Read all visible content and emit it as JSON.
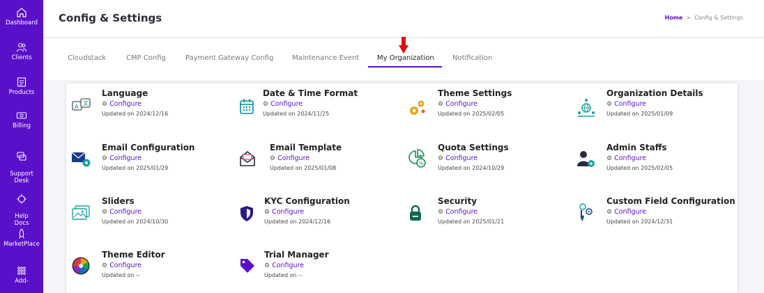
{
  "sidebar": {
    "items": [
      {
        "label": "Dashboard",
        "icon": "home-icon"
      },
      {
        "label": "Clients",
        "icon": "users-icon"
      },
      {
        "label": "Products",
        "icon": "products-icon"
      },
      {
        "label": "Billing",
        "icon": "billing-icon"
      },
      {
        "label": "Support\nDesk",
        "icon": "support-icon"
      },
      {
        "label": "Help\nDocs",
        "icon": "help-icon"
      },
      {
        "label": "MarketPlace",
        "icon": "rocket-icon"
      },
      {
        "label": "Add-",
        "icon": "grid-icon"
      }
    ]
  },
  "header": {
    "title": "Config & Settings",
    "breadcrumb": {
      "home": "Home",
      "separator": ">",
      "current": "Config & Settings"
    }
  },
  "tabs": [
    {
      "label": "Cloudstack"
    },
    {
      "label": "CMP Config"
    },
    {
      "label": "Payment Gateway Config"
    },
    {
      "label": "Maintenance Event"
    },
    {
      "label": "My Organization"
    },
    {
      "label": "Notification"
    }
  ],
  "active_tab": "My Organization",
  "accent_color": "#5a0fc8",
  "configure_label": "Configure",
  "tiles": [
    {
      "title": "Language",
      "updated": "Updated on 2024/12/16",
      "icon": "language-icon"
    },
    {
      "title": "Date & Time Format",
      "updated": "Updated on 2024/11/25",
      "icon": "calendar-icon"
    },
    {
      "title": "Theme Settings",
      "updated": "Updated on 2025/02/05",
      "icon": "gears-icon"
    },
    {
      "title": "Organization Details",
      "updated": "Updated on 2025/01/09",
      "icon": "organization-icon"
    },
    {
      "title": "Email Configuration",
      "updated": "Updated on 2025/01/29",
      "icon": "email-config-icon"
    },
    {
      "title": "Email Template",
      "updated": "Updated on 2025/01/08",
      "icon": "email-template-icon"
    },
    {
      "title": "Quota Settings",
      "updated": "Updated on 2024/10/29",
      "icon": "quota-icon"
    },
    {
      "title": "Admin Staffs",
      "updated": "Updated on 2025/02/05",
      "icon": "admin-icon"
    },
    {
      "title": "Sliders",
      "updated": "Updated on 2024/10/30",
      "icon": "sliders-icon"
    },
    {
      "title": "KYC Configuration",
      "updated": "Updated on 2024/12/16",
      "icon": "shield-icon"
    },
    {
      "title": "Security",
      "updated": "Updated on 2025/01/21",
      "icon": "lock-icon"
    },
    {
      "title": "Custom Field Configuration",
      "updated": "Updated on 2024/12/31",
      "icon": "custom-field-icon"
    },
    {
      "title": "Theme Editor",
      "updated": "Updated on --",
      "icon": "palette-icon"
    },
    {
      "title": "Trial Manager",
      "updated": "Updated on --",
      "icon": "tag-icon"
    }
  ]
}
